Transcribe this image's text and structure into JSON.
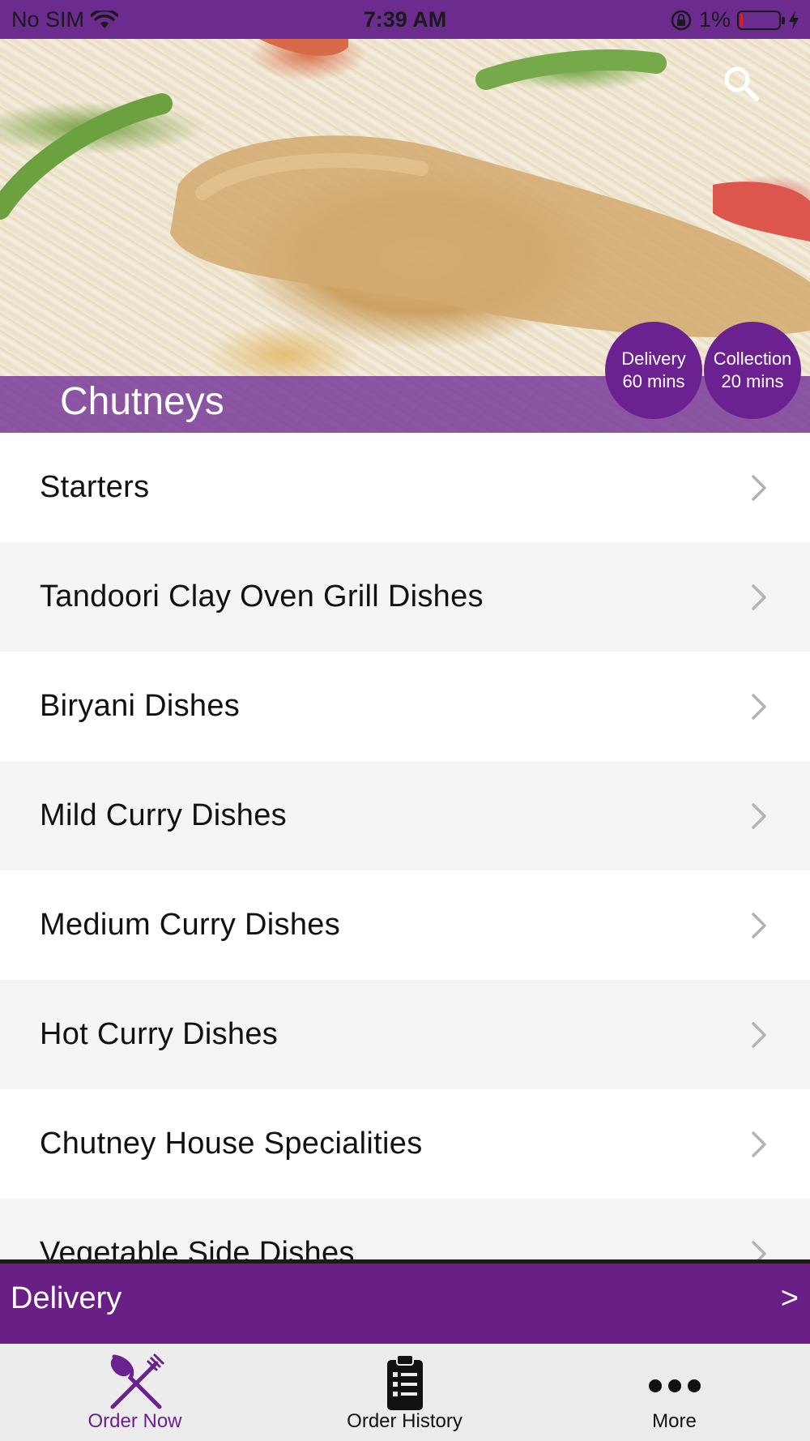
{
  "status_bar": {
    "carrier": "No SIM",
    "time": "7:39 AM",
    "battery_percent": "1%",
    "battery_level": 0.01
  },
  "hero": {
    "title": "Chutneys",
    "badges": {
      "delivery": {
        "label": "Delivery",
        "time": "60 mins"
      },
      "collection": {
        "label": "Collection",
        "time": "20 mins"
      }
    }
  },
  "menu": {
    "items": [
      {
        "label": "Starters"
      },
      {
        "label": "Tandoori Clay Oven Grill Dishes"
      },
      {
        "label": "Biryani Dishes"
      },
      {
        "label": "Mild Curry Dishes"
      },
      {
        "label": "Medium Curry Dishes"
      },
      {
        "label": "Hot Curry Dishes"
      },
      {
        "label": "Chutney House Specialities"
      },
      {
        "label": "Vegetable Side Dishes"
      }
    ]
  },
  "delivery_bar": {
    "label": "Delivery",
    "arrow": ">"
  },
  "tab_bar": {
    "tabs": [
      {
        "label": "Order Now",
        "icon": "fork-knife-icon",
        "active": true
      },
      {
        "label": "Order History",
        "icon": "clipboard-icon",
        "active": false
      },
      {
        "label": "More",
        "icon": "more-dots-icon",
        "active": false
      }
    ]
  },
  "colors": {
    "brand_purple": "#6b2190",
    "accent_purple": "#6a1f87",
    "battery_red": "#e02020"
  }
}
